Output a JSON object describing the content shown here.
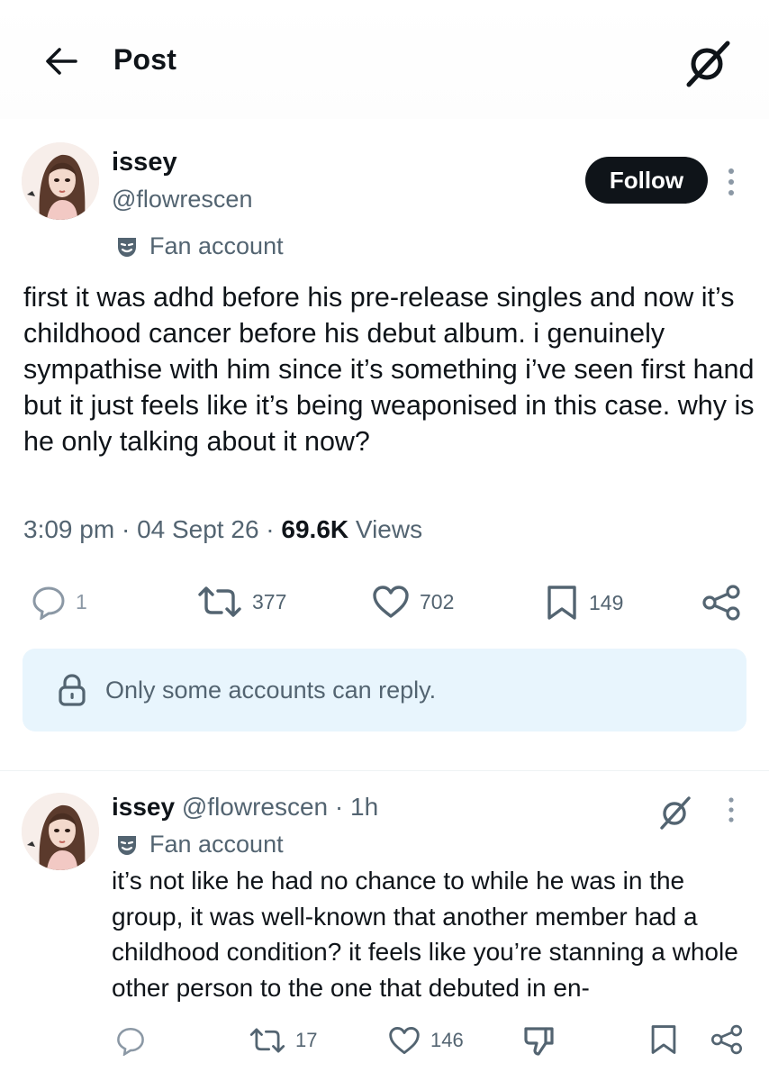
{
  "header": {
    "title": "Post",
    "back_icon": "arrow-left-icon",
    "grok_icon": "grok-icon"
  },
  "post": {
    "author": {
      "name": "issey",
      "handle": "@flowrescen",
      "badge": "Fan account"
    },
    "follow_label": "Follow",
    "text": "first it was adhd before his pre-release singles and now it’s childhood cancer before his debut album. i genuinely sympathise with him since it’s something i’ve seen first hand but it just feels like it’s being weaponised in this case. why is he only talking about it now?",
    "time": "3:09 pm",
    "date": "04 Sept 26",
    "views_count": "69.6K",
    "views_label": "Views",
    "stats": {
      "replies": "1",
      "reposts": "377",
      "likes": "702",
      "bookmarks": "149"
    }
  },
  "reply_notice": "Only some accounts can reply.",
  "reply": {
    "author": {
      "name": "issey",
      "handle": "@flowrescen",
      "time": "1h",
      "badge": "Fan account"
    },
    "text": "it’s not like he had no chance to while he was in the group, it was well-known that another member had a childhood condition? it feels like you’re stanning a whole other person to the one that debuted in en-",
    "stats": {
      "reposts": "17",
      "likes": "146"
    }
  },
  "colors": {
    "text": "#0f1419",
    "secondary": "#536471",
    "notice_bg": "#e8f5fd",
    "follow_bg": "#0f1419"
  }
}
